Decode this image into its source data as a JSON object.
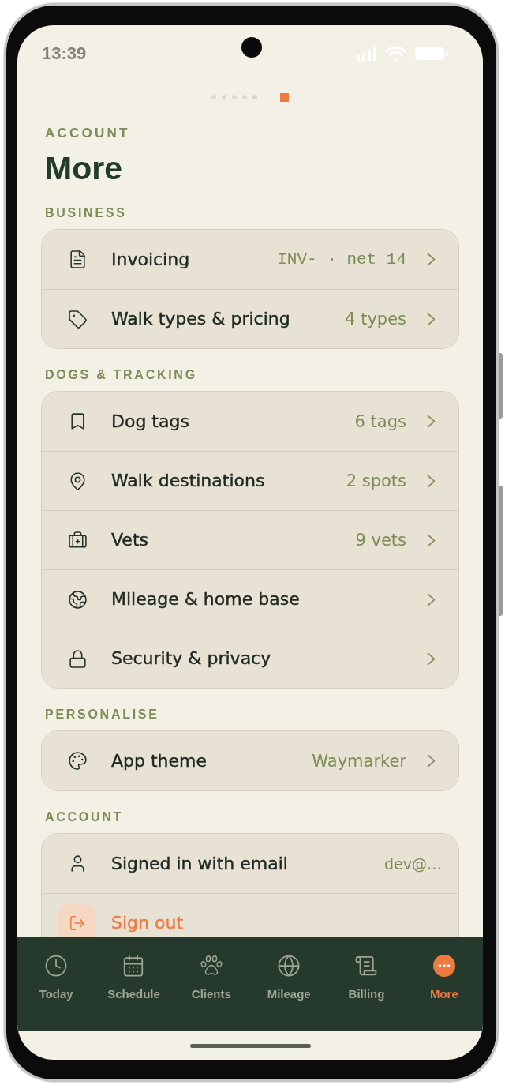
{
  "status_bar": {
    "time": "13:39"
  },
  "page_indicator": [
    {
      "selected": false
    },
    {
      "selected": false
    },
    {
      "selected": false
    },
    {
      "selected": false
    },
    {
      "selected": false
    },
    {
      "selected": true
    }
  ],
  "header": {
    "eyebrow": "ACCOUNT",
    "title": "More"
  },
  "sections": [
    {
      "title": "BUSINESS",
      "items": [
        {
          "kind": "code",
          "label": "Invoicing",
          "value": "INV- · net 14"
        },
        {
          "kind": "link",
          "label": "Walk types & pricing",
          "value": "4 types"
        }
      ]
    },
    {
      "title": "DOGS & TRACKING",
      "items": [
        {
          "kind": "link",
          "label": "Dog tags",
          "value": "6 tags"
        },
        {
          "kind": "link",
          "label": "Walk destinations",
          "value": "2 spots"
        },
        {
          "kind": "link",
          "label": "Vets",
          "value": "9 vets"
        },
        {
          "kind": "link",
          "label": "Mileage & home base"
        },
        {
          "kind": "link",
          "label": "Security & privacy"
        }
      ]
    },
    {
      "title": "PERSONALISE",
      "items": [
        {
          "kind": "link",
          "label": "App theme",
          "value": "Waymarker"
        }
      ]
    },
    {
      "title": "ACCOUNT",
      "items": [
        {
          "kind": "info",
          "label": "Signed in with email",
          "value": "dev@…"
        },
        {
          "kind": "danger",
          "label": "Sign out"
        }
      ]
    }
  ],
  "tab_bar": [
    {
      "label": "Today",
      "selected": false
    },
    {
      "label": "Schedule",
      "selected": false
    },
    {
      "label": "Clients",
      "selected": false
    },
    {
      "label": "Mileage",
      "selected": false
    },
    {
      "label": "Billing",
      "selected": false
    },
    {
      "label": "More",
      "selected": true
    }
  ]
}
